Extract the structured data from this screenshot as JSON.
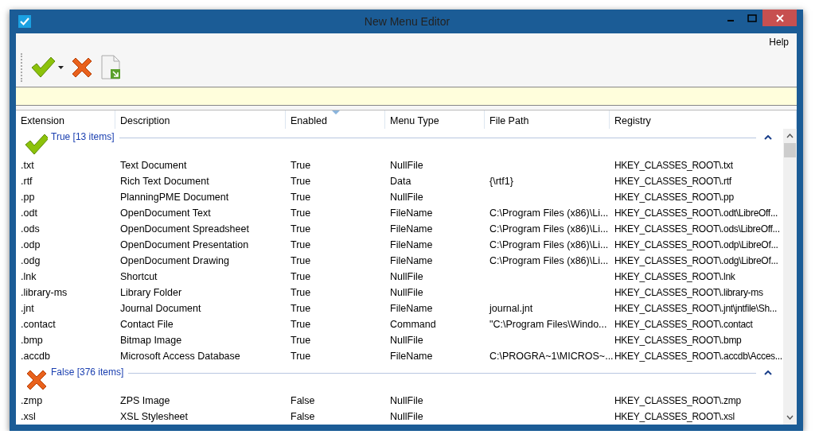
{
  "window": {
    "title": "New Menu Editor"
  },
  "menu": [
    "Help"
  ],
  "toolbar": [
    {
      "kind": "check",
      "dropdown": true
    },
    {
      "kind": "cross",
      "dropdown": false
    },
    {
      "kind": "export",
      "dropdown": false
    }
  ],
  "table": {
    "columns": [
      {
        "label": "Extension",
        "sorted": false
      },
      {
        "label": "Description",
        "sorted": false
      },
      {
        "label": "Enabled",
        "sorted": true
      },
      {
        "label": "Menu Type",
        "sorted": false
      },
      {
        "label": "File Path",
        "sorted": false
      },
      {
        "label": "Registry",
        "sorted": false
      }
    ],
    "groups": [
      {
        "kind": "check",
        "label": "True [13 items]",
        "expanded": true,
        "rows": [
          [
            ".txt",
            "Text Document",
            "True",
            "NullFile",
            "",
            "HKEY_CLASSES_ROOT\\.txt"
          ],
          [
            ".rtf",
            "Rich Text Document",
            "True",
            "Data",
            "{\\rtf1}",
            "HKEY_CLASSES_ROOT\\.rtf"
          ],
          [
            ".pp",
            "PlanningPME Document",
            "True",
            "NullFile",
            "",
            "HKEY_CLASSES_ROOT\\.pp"
          ],
          [
            ".odt",
            "OpenDocument Text",
            "True",
            "FileName",
            "C:\\Program Files (x86)\\Li...",
            "HKEY_CLASSES_ROOT\\.odt\\LibreOff..."
          ],
          [
            ".ods",
            "OpenDocument Spreadsheet",
            "True",
            "FileName",
            "C:\\Program Files (x86)\\Li...",
            "HKEY_CLASSES_ROOT\\.ods\\LibreOff..."
          ],
          [
            ".odp",
            "OpenDocument Presentation",
            "True",
            "FileName",
            "C:\\Program Files (x86)\\Li...",
            "HKEY_CLASSES_ROOT\\.odp\\LibreOf..."
          ],
          [
            ".odg",
            "OpenDocument Drawing",
            "True",
            "FileName",
            "C:\\Program Files (x86)\\Li...",
            "HKEY_CLASSES_ROOT\\.odg\\LibreOf..."
          ],
          [
            ".lnk",
            "Shortcut",
            "True",
            "NullFile",
            "",
            "HKEY_CLASSES_ROOT\\.lnk"
          ],
          [
            ".library-ms",
            "Library Folder",
            "True",
            "NullFile",
            "",
            "HKEY_CLASSES_ROOT\\.library-ms"
          ],
          [
            ".jnt",
            "Journal Document",
            "True",
            "FileName",
            "journal.jnt",
            "HKEY_CLASSES_ROOT\\.jnt\\jntfile\\Sh..."
          ],
          [
            ".contact",
            "Contact File",
            "True",
            "Command",
            "\"C:\\Program Files\\Windo...",
            "HKEY_CLASSES_ROOT\\.contact"
          ],
          [
            ".bmp",
            "Bitmap Image",
            "True",
            "NullFile",
            "",
            "HKEY_CLASSES_ROOT\\.bmp"
          ],
          [
            ".accdb",
            "Microsoft Access Database",
            "True",
            "FileName",
            "C:\\PROGRA~1\\MICROS~...",
            "HKEY_CLASSES_ROOT\\.accdb\\Acces..."
          ]
        ]
      },
      {
        "kind": "cross",
        "label": "False [376 items]",
        "expanded": true,
        "rows": [
          [
            ".zmp",
            "ZPS Image",
            "False",
            "NullFile",
            "",
            "HKEY_CLASSES_ROOT\\.zmp"
          ],
          [
            ".xsl",
            "XSL Stylesheet",
            "False",
            "NullFile",
            "",
            "HKEY_CLASSES_ROOT\\.xsl"
          ]
        ]
      }
    ]
  }
}
